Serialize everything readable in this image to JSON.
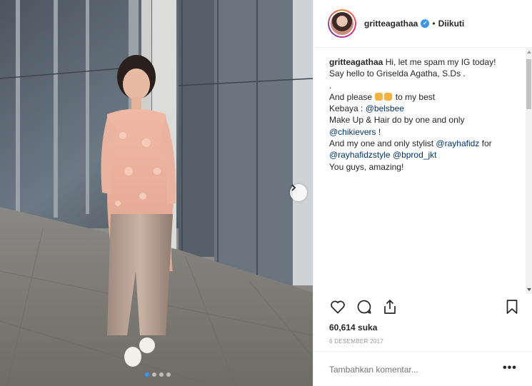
{
  "post": {
    "username": "gritteagathaa",
    "separator": "•",
    "follow_state": "Diikuti",
    "caption": {
      "l1_text": "Hi, let me spam my IG today!",
      "l2": "Say hello to Griselda Agatha, S.Ds .",
      "l3": ".",
      "l4_pre": "And please",
      "l4_post": "to my best",
      "l5_pre": "Kebaya :",
      "l5_link": "@belsbee",
      "l6": "Make Up & Hair do by one and only",
      "l7_link": "@chikievers",
      "l7_post": "!",
      "l8_pre": "And my one and only stylist",
      "l8_link": "@rayhafidz",
      "l8_post": "for",
      "l9_link1": "@rayhafidzstyle",
      "l9_link2": "@bprod_jkt",
      "l10": "You guys, amazing!"
    },
    "likes": "60,614 suka",
    "date": "6 DESEMBER 2017",
    "comment_placeholder": "Tambahkan komentar...",
    "more": "•••"
  },
  "carousel": {
    "count": 4,
    "active": 1
  },
  "icons": {
    "verified": "verified-badge-icon",
    "like": "heart-icon",
    "comment": "comment-icon",
    "share": "share-icon",
    "save": "bookmark-icon",
    "next": "chevron-right-icon"
  },
  "colors": {
    "link": "#003569",
    "verified": "#3897f0",
    "muted": "#999999",
    "text": "#262626"
  }
}
